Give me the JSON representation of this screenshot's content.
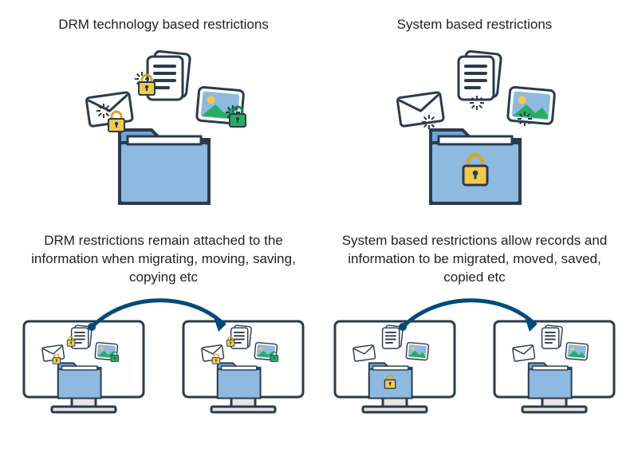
{
  "top_left": {
    "title": "DRM technology based restrictions"
  },
  "top_right": {
    "title": "System based restrictions"
  },
  "bottom_left": {
    "title": "DRM restrictions remain attached to the information when migrating, moving, saving, copying etc"
  },
  "bottom_right": {
    "title": "System based restrictions allow records and information to be migrated, moved, saved, copied etc"
  },
  "colors": {
    "outline": "#2a3b4d",
    "folder_fill": "#6ea3d6",
    "folder_front": "#8eb9e0",
    "lock_body": "#f2c94c",
    "lock_shackle": "#d4a82a",
    "lock_green": "#27ae60",
    "paper": "#ffffff",
    "image_sky": "#8eb9e0",
    "image_sun": "#f2c94c",
    "image_hill": "#27ae60",
    "monitor_base": "#e6e6e6",
    "arrow": "#004a7c"
  }
}
